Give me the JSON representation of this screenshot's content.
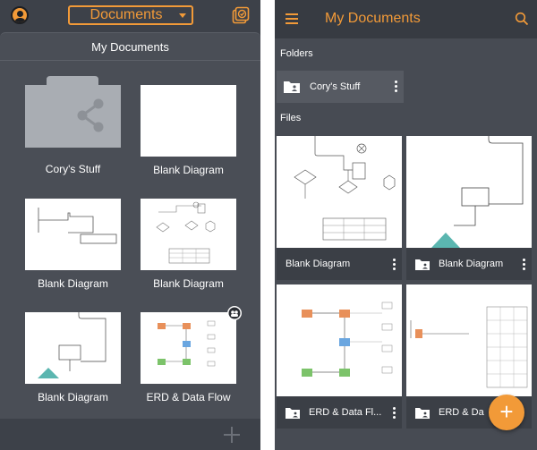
{
  "left": {
    "header_dropdown": "Documents",
    "panel_title": "My Documents",
    "tiles": [
      {
        "label": "Cory's Stuff"
      },
      {
        "label": "Blank Diagram"
      },
      {
        "label": "Blank Diagram"
      },
      {
        "label": "Blank Diagram"
      },
      {
        "label": "Blank Diagram"
      },
      {
        "label": "ERD & Data Flow"
      }
    ]
  },
  "right": {
    "title": "My Documents",
    "folders_heading": "Folders",
    "folder": {
      "label": "Cory's Stuff"
    },
    "files_heading": "Files",
    "files": [
      {
        "label": "Blank Diagram"
      },
      {
        "label": "Blank Diagram"
      },
      {
        "label": "ERD & Data Fl..."
      },
      {
        "label": "ERD & Da"
      }
    ],
    "fab_symbol": "+"
  },
  "colors": {
    "accent": "#f29a38",
    "dark_bg": "#3d4149",
    "card_bg": "#4a4e56",
    "diamond": "#5bb6b0"
  },
  "icons": [
    "avatar-icon",
    "chevron-down-icon",
    "sync-icon",
    "plus-icon",
    "menu-icon",
    "search-icon",
    "folder-shared-icon",
    "more-vert-icon",
    "collaborators-icon"
  ]
}
